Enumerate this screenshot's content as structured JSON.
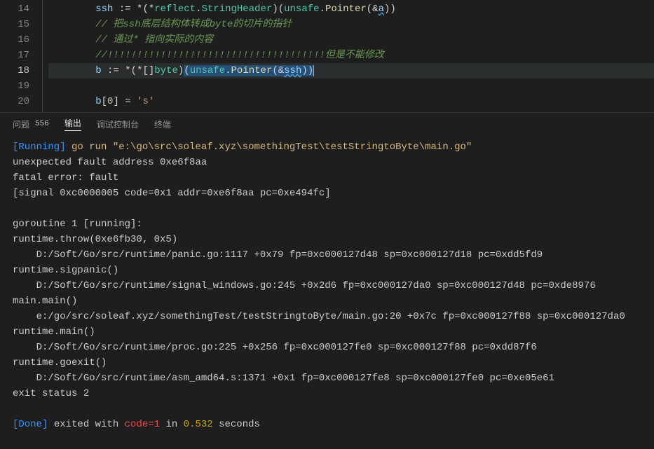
{
  "editor": {
    "lines": [
      {
        "num": "14",
        "indent": "        ",
        "tokens": [
          {
            "t": "ssh ",
            "c": "tok-var"
          },
          {
            "t": ":= ",
            "c": "tok-op"
          },
          {
            "t": "*",
            "c": "tok-op"
          },
          {
            "t": "(",
            "c": "tok-paren"
          },
          {
            "t": "*",
            "c": "tok-op"
          },
          {
            "t": "reflect",
            "c": "tok-pkg"
          },
          {
            "t": ".",
            "c": "tok-op"
          },
          {
            "t": "StringHeader",
            "c": "tok-type"
          },
          {
            "t": ")",
            "c": "tok-paren"
          },
          {
            "t": "(",
            "c": "tok-paren"
          },
          {
            "t": "unsafe",
            "c": "tok-pkg"
          },
          {
            "t": ".",
            "c": "tok-op"
          },
          {
            "t": "Pointer",
            "c": "tok-call"
          },
          {
            "t": "(",
            "c": "tok-paren"
          },
          {
            "t": "&",
            "c": "tok-op"
          },
          {
            "t": "a",
            "c": "tok-var",
            "wavy": true
          },
          {
            "t": ")",
            "c": "tok-paren"
          },
          {
            "t": ")",
            "c": "tok-paren"
          }
        ]
      },
      {
        "num": "15",
        "indent": "        ",
        "tokens": [
          {
            "t": "// 把ssh底层结构体转成byte的切片的指针",
            "c": "tok-comment"
          }
        ]
      },
      {
        "num": "16",
        "indent": "        ",
        "tokens": [
          {
            "t": "// 通过* 指向实际的内容",
            "c": "tok-comment"
          }
        ]
      },
      {
        "num": "17",
        "indent": "        ",
        "tokens": [
          {
            "t": "//!!!!!!!!!!!!!!!!!!!!!!!!!!!!!!!!!!!!!但是不能修改",
            "c": "tok-comment"
          }
        ]
      },
      {
        "num": "18",
        "current": true,
        "indent": "        ",
        "tokens": [
          {
            "t": "b ",
            "c": "tok-var"
          },
          {
            "t": ":= ",
            "c": "tok-op"
          },
          {
            "t": "*",
            "c": "tok-op"
          },
          {
            "t": "(",
            "c": "tok-paren"
          },
          {
            "t": "*",
            "c": "tok-op"
          },
          {
            "t": "[]",
            "c": "tok-op"
          },
          {
            "t": "byte",
            "c": "tok-type"
          },
          {
            "t": ")",
            "c": "tok-paren"
          },
          {
            "t": "(",
            "c": "tok-paren",
            "sel": true
          },
          {
            "t": "unsafe",
            "c": "tok-pkg",
            "sel": true
          },
          {
            "t": ".",
            "c": "tok-op",
            "sel": true
          },
          {
            "t": "Pointer",
            "c": "tok-call",
            "sel": true
          },
          {
            "t": "(",
            "c": "tok-paren",
            "sel": true
          },
          {
            "t": "&",
            "c": "tok-op",
            "sel": true
          },
          {
            "t": "ssh",
            "c": "tok-var",
            "sel": true,
            "wavy": true
          },
          {
            "t": ")",
            "c": "tok-paren",
            "sel": true
          },
          {
            "t": ")",
            "c": "tok-paren",
            "sel": true
          },
          {
            "t": "",
            "cursor": true
          }
        ]
      },
      {
        "num": "19",
        "indent": "",
        "tokens": []
      },
      {
        "num": "20",
        "indent": "        ",
        "tokens": [
          {
            "t": "b",
            "c": "tok-var"
          },
          {
            "t": "[",
            "c": "tok-paren"
          },
          {
            "t": "0",
            "c": "tok-num"
          },
          {
            "t": "]",
            "c": "tok-paren"
          },
          {
            "t": " = ",
            "c": "tok-op"
          },
          {
            "t": "'s'",
            "c": "tok-str"
          }
        ]
      }
    ]
  },
  "panel": {
    "tabs": {
      "problems": "问题",
      "problems_count": "556",
      "output": "输出",
      "debug": "调试控制台",
      "terminal": "终端"
    }
  },
  "terminal": {
    "lines": [
      [
        {
          "t": "[Running]",
          "c": "t-cyan"
        },
        {
          "t": " go run \"e:\\go\\src\\soleaf.xyz\\somethingTest\\testStringtoByte\\main.go\"",
          "c": "t-yellow"
        }
      ],
      [
        {
          "t": "unexpected fault address 0xe6f8aa",
          "c": "t-plain"
        }
      ],
      [
        {
          "t": "fatal error: fault",
          "c": "t-plain"
        }
      ],
      [
        {
          "t": "[signal 0xc0000005 code=0x1 addr=0xe6f8aa pc=0xe494fc]",
          "c": "t-plain"
        }
      ],
      [
        {
          "t": "",
          "c": "t-plain"
        }
      ],
      [
        {
          "t": "goroutine 1 [running]:",
          "c": "t-plain"
        }
      ],
      [
        {
          "t": "runtime.throw(0xe6fb30, 0x5)",
          "c": "t-plain"
        }
      ],
      [
        {
          "t": "    D:/Soft/Go/src/runtime/panic.go:1117 +0x79 fp=0xc000127d48 sp=0xc000127d18 pc=0xdd5fd9",
          "c": "t-plain"
        }
      ],
      [
        {
          "t": "runtime.sigpanic()",
          "c": "t-plain"
        }
      ],
      [
        {
          "t": "    D:/Soft/Go/src/runtime/signal_windows.go:245 +0x2d6 fp=0xc000127da0 sp=0xc000127d48 pc=0xde8976",
          "c": "t-plain"
        }
      ],
      [
        {
          "t": "main.main()",
          "c": "t-plain"
        }
      ],
      [
        {
          "t": "    e:/go/src/soleaf.xyz/somethingTest/testStringtoByte/main.go:20 +0x7c fp=0xc000127f88 sp=0xc000127da0",
          "c": "t-plain"
        }
      ],
      [
        {
          "t": "runtime.main()",
          "c": "t-plain"
        }
      ],
      [
        {
          "t": "    D:/Soft/Go/src/runtime/proc.go:225 +0x256 fp=0xc000127fe0 sp=0xc000127f88 pc=0xdd87f6",
          "c": "t-plain"
        }
      ],
      [
        {
          "t": "runtime.goexit()",
          "c": "t-plain"
        }
      ],
      [
        {
          "t": "    D:/Soft/Go/src/runtime/asm_amd64.s:1371 +0x1 fp=0xc000127fe8 sp=0xc000127fe0 pc=0xe05e61",
          "c": "t-plain"
        }
      ],
      [
        {
          "t": "exit status 2",
          "c": "t-plain"
        }
      ],
      [
        {
          "t": "",
          "c": "t-plain"
        }
      ],
      [
        {
          "t": "[Done]",
          "c": "t-cyan"
        },
        {
          "t": " exited with ",
          "c": "t-plain"
        },
        {
          "t": "code=1",
          "c": "t-red"
        },
        {
          "t": " in ",
          "c": "t-plain"
        },
        {
          "t": "0.532",
          "c": "t-yellow2"
        },
        {
          "t": " seconds",
          "c": "t-plain"
        }
      ]
    ]
  }
}
